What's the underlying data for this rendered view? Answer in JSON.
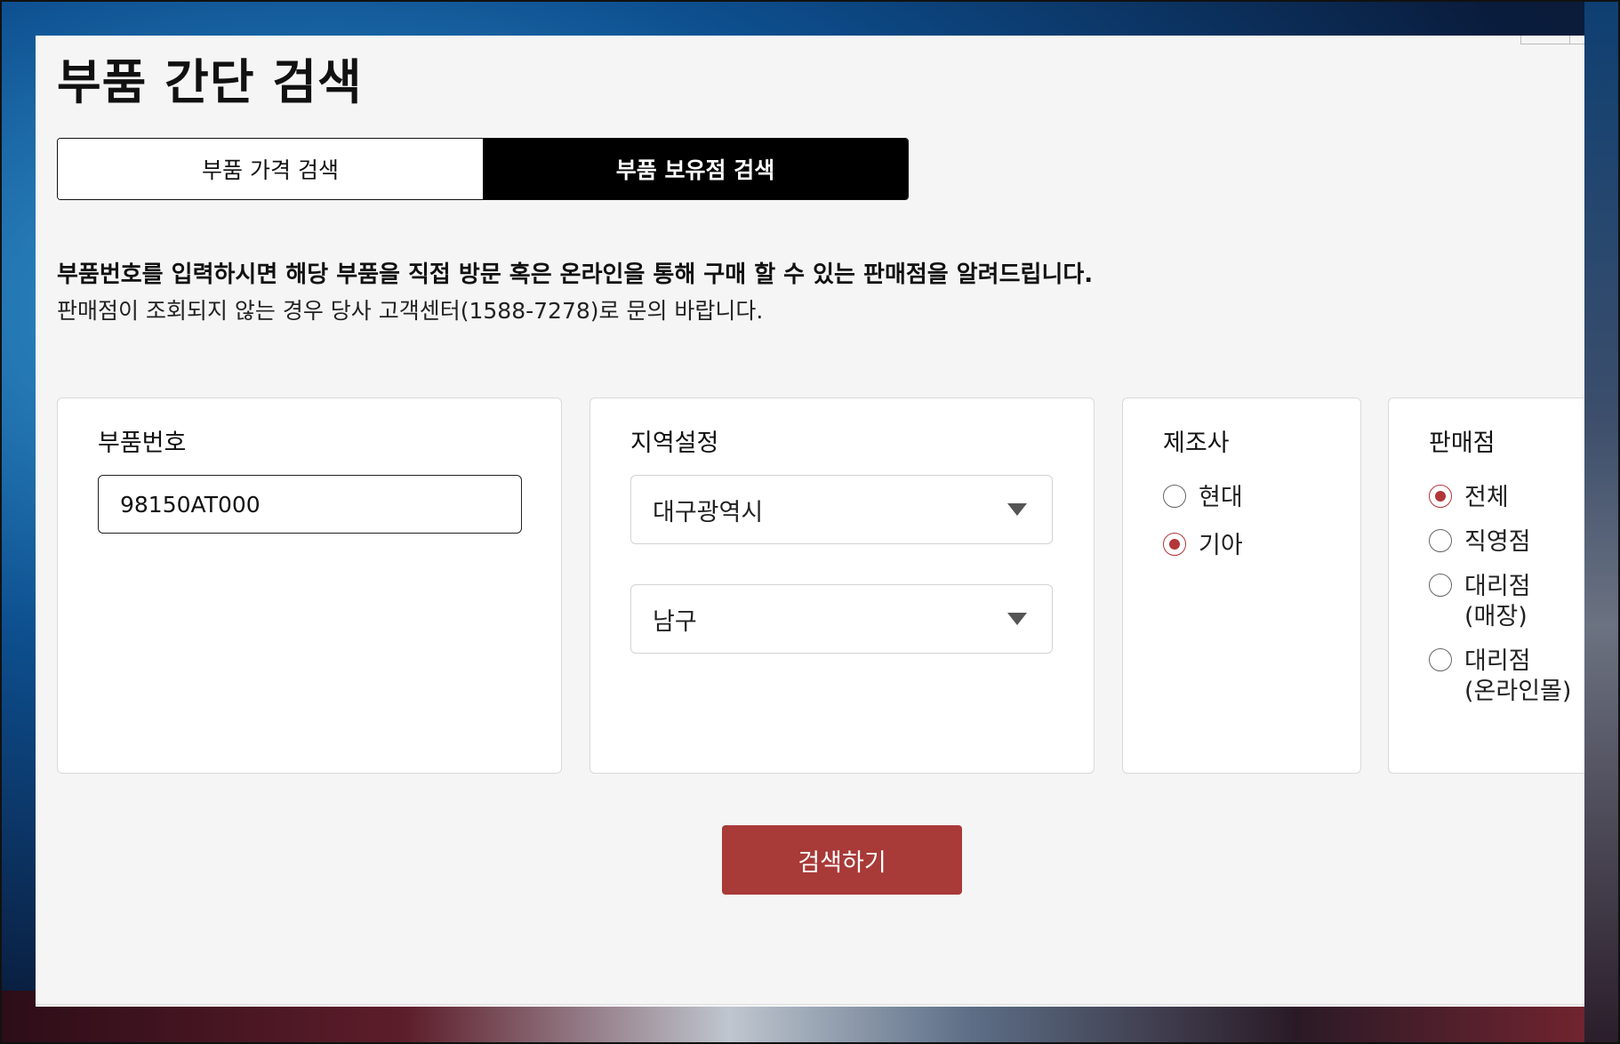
{
  "page": {
    "title": "부품 간단 검색"
  },
  "tabs": [
    {
      "label": "부품 가격 검색",
      "active": false
    },
    {
      "label": "부품 보유점 검색",
      "active": true
    }
  ],
  "description": {
    "bold": "부품번호를 입력하시면 해당 부품을 직접 방문 혹은 온라인을 통해 구매 할 수 있는 판매점을 알려드립니다.",
    "normal": "판매점이 조회되지 않는 경우 당사 고객센터(1588-7278)로 문의 바랍니다."
  },
  "part_number": {
    "label": "부품번호",
    "value": "98150AT000"
  },
  "region": {
    "label": "지역설정",
    "city": "대구광역시",
    "district": "남구"
  },
  "maker": {
    "label": "제조사",
    "options": [
      {
        "label": "현대",
        "checked": false
      },
      {
        "label": "기아",
        "checked": true
      }
    ]
  },
  "store": {
    "label": "판매점",
    "options": [
      {
        "line1": "전체",
        "line2": "",
        "checked": true
      },
      {
        "line1": "직영점",
        "line2": "",
        "checked": false
      },
      {
        "line1": "대리점",
        "line2": "(매장)",
        "checked": false
      },
      {
        "line1": "대리점",
        "line2": "(온라인몰)",
        "checked": false
      }
    ]
  },
  "search_button": {
    "label": "검색하기"
  },
  "colors": {
    "accent": "#a83a38",
    "active_tab": "#000000",
    "radio_checked": "#b2363a"
  }
}
